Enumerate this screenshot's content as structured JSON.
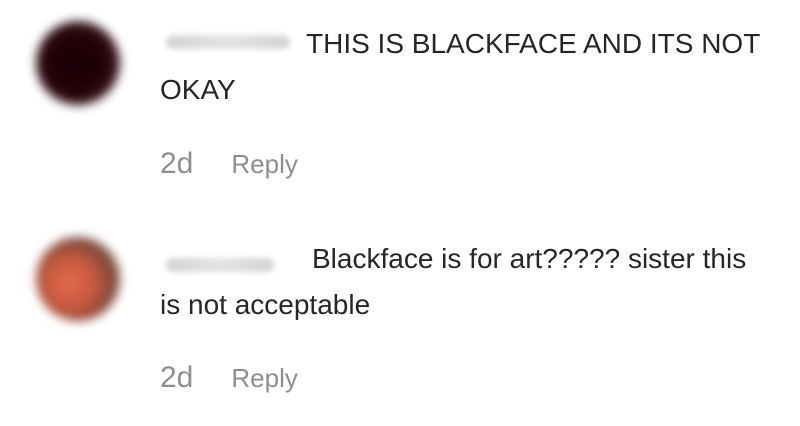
{
  "comments": [
    {
      "text": "THIS IS BLACKFACE AND ITS NOT OKAY",
      "time": "2d",
      "reply_label": "Reply"
    },
    {
      "text": "Blackface is for art????? sister this is not acceptable",
      "time": "2d",
      "reply_label": "Reply"
    }
  ]
}
